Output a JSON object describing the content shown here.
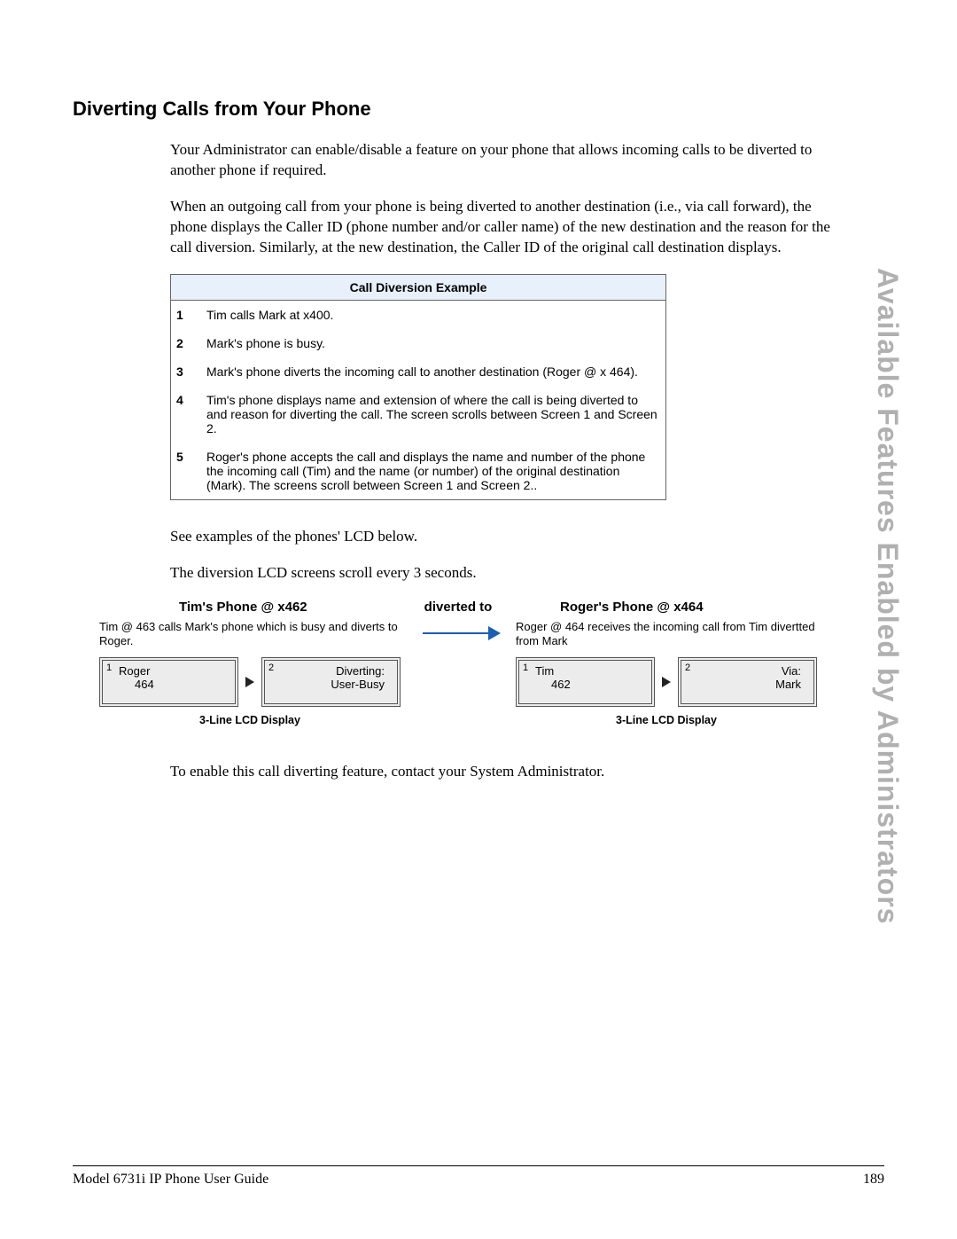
{
  "side_title": "Available Features Enabled by Administrators",
  "section_title": "Diverting Calls from Your Phone",
  "paragraphs": {
    "p1": "Your Administrator can enable/disable a feature on your phone that allows incoming calls to be diverted to another phone if required.",
    "p2": "When an outgoing call from your phone is being diverted to another destination (i.e., via call forward), the phone displays the Caller ID (phone number and/or caller name) of the new destination and the reason for the call diversion. Similarly, at the new destination, the Caller ID of the original call destination displays.",
    "p3": "See examples of the phones' LCD below.",
    "p4": "The diversion LCD screens scroll every 3 seconds.",
    "p5": "To enable this call diverting feature, contact your System Administrator."
  },
  "table": {
    "header": "Call Diversion Example",
    "rows": [
      {
        "n": "1",
        "text": "Tim calls Mark at x400."
      },
      {
        "n": "2",
        "text": "Mark's phone is busy."
      },
      {
        "n": "3",
        "text": "Mark's phone diverts the incoming call to another destination (Roger @ x 464)."
      },
      {
        "n": "4",
        "text": "Tim's phone displays name and extension of where the call is being diverted to and reason for diverting the call. The screen scrolls between Screen 1 and Screen 2."
      },
      {
        "n": "5",
        "text": "Roger's phone accepts the call and displays the name and number of the phone the incoming call (Tim) and the name (or number) of the original destination (Mark). The screens scroll between Screen 1 and Screen 2.."
      }
    ]
  },
  "diagram": {
    "divert_label": "diverted to",
    "left": {
      "title": "Tim's Phone @ x462",
      "desc": "Tim @ 463 calls Mark's phone which is busy and diverts to Roger.",
      "lcd1": {
        "num": "1",
        "line1": "Roger",
        "line2": "464"
      },
      "lcd2": {
        "num": "2",
        "line1": "Diverting:",
        "line2": "User-Busy"
      },
      "caption": "3-Line LCD Display"
    },
    "right": {
      "title": "Roger's Phone @ x464",
      "desc": "Roger @ 464 receives the incoming call from Tim divertted from Mark",
      "lcd1": {
        "num": "1",
        "line1": "Tim",
        "line2": "462"
      },
      "lcd2": {
        "num": "2",
        "line1": "Via:",
        "line2": "Mark"
      },
      "caption": "3-Line LCD Display"
    }
  },
  "footer": {
    "left": "Model 6731i IP Phone User Guide",
    "right": "189"
  }
}
